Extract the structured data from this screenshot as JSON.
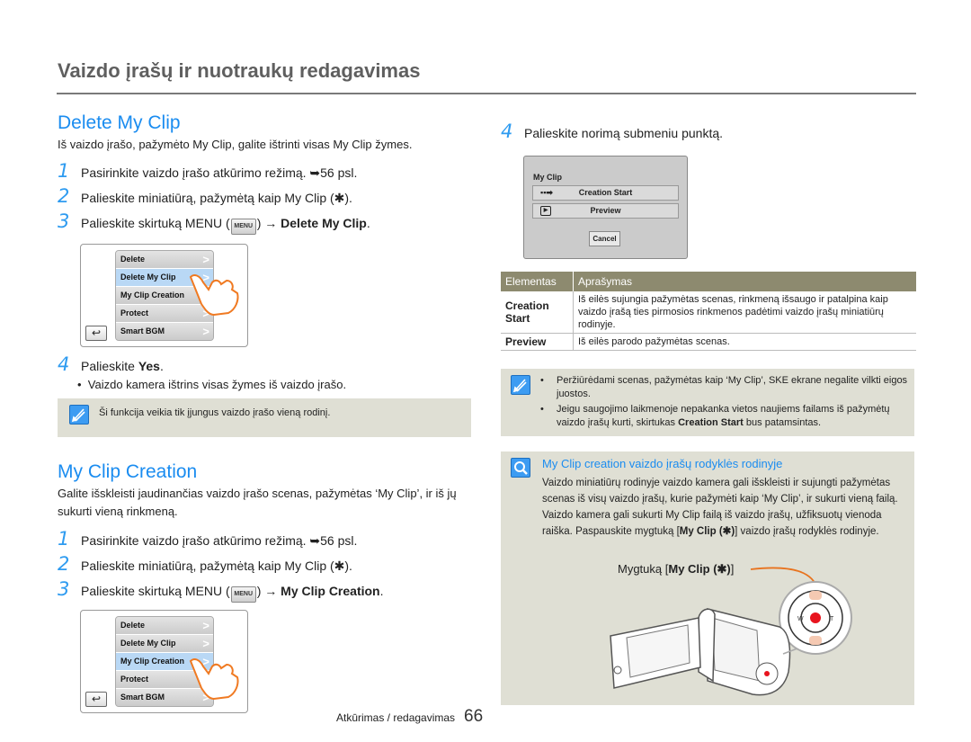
{
  "page": {
    "title": "Vaizdo įrašų ir nuotraukų redagavimas",
    "footer_section": "Atkūrimas / redagavimas",
    "page_number": "66"
  },
  "delete_section": {
    "title": "Delete My Clip",
    "intro": "Iš vaizdo įrašo, pažymėto My Clip, galite ištrinti visas My Clip žymes.",
    "steps": [
      {
        "num": "1",
        "text": "Pasirinkite vaizdo įrašo atkūrimo režimą. ➥56 psl."
      },
      {
        "num": "2",
        "text": "Palieskite miniatiūrą, pažymėtą kaip My Clip (✱)."
      },
      {
        "num": "3",
        "text_before": "Palieskite skirtuką MENU (",
        "menu_icon": "MENU",
        "text_after": ") → ",
        "bold": "Delete My Clip",
        "end": "."
      }
    ],
    "menu_items": [
      {
        "label": "Delete",
        "selected": false
      },
      {
        "label": "Delete My Clip",
        "selected": true
      },
      {
        "label": "My Clip Creation",
        "selected": false
      },
      {
        "label": "Protect",
        "selected": false
      },
      {
        "label": "Smart BGM",
        "selected": false
      }
    ],
    "step4": {
      "num": "4",
      "text": "Palieskite ",
      "bold": "Yes",
      "end": "."
    },
    "bullet": "Vaizdo kamera ištrins visas žymes iš vaizdo įrašo.",
    "note": "Ši funkcija veikia tik įjungus vaizdo įrašo vieną rodinį."
  },
  "creation_section": {
    "title": "My Clip Creation",
    "intro": "Galite išskleisti jaudinančias vaizdo įrašo scenas, pažymėtas ‘My Clip’, ir iš jų sukurti vieną rinkmeną.",
    "steps": [
      {
        "num": "1",
        "text": "Pasirinkite vaizdo įrašo atkūrimo režimą. ➥56 psl."
      },
      {
        "num": "2",
        "text": "Palieskite miniatiūrą, pažymėtą kaip My Clip (✱)."
      },
      {
        "num": "3",
        "text_before": "Palieskite skirtuką MENU (",
        "menu_icon": "MENU",
        "text_after": ") → ",
        "bold": "My Clip Creation",
        "end": "."
      }
    ],
    "menu_items": [
      {
        "label": "Delete",
        "selected": false
      },
      {
        "label": "Delete My Clip",
        "selected": false
      },
      {
        "label": "My Clip Creation",
        "selected": true
      },
      {
        "label": "Protect",
        "selected": false
      },
      {
        "label": "Smart BGM",
        "selected": false
      }
    ]
  },
  "right": {
    "step4": {
      "num": "4",
      "text": "Palieskite norimą submeniu punktą."
    },
    "dialog": {
      "title": "My Clip",
      "buttons": [
        {
          "icon": "creation-start-icon",
          "label": "Creation Start"
        },
        {
          "icon": "preview-play-icon",
          "label": "Preview"
        }
      ],
      "cancel": "Cancel"
    },
    "table": {
      "headers": [
        "Elementas",
        "Aprašymas"
      ],
      "rows": [
        {
          "key": "Creation Start",
          "value": "Iš eilės sujungia pažymėtas scenas, rinkmeną išsaugo ir patalpina kaip vaizdo įrašą ties pirmosios rinkmenos padėtimi vaizdo įrašų miniatiūrų rodinyje."
        },
        {
          "key": "Preview",
          "value": "Iš eilės parodo pažymėtas scenas."
        }
      ]
    },
    "notes": [
      "Peržiūrėdami scenas, pažymėtas kaip ‘My Clip’, SKE ekrane negalite vilkti eigos juostos.",
      {
        "before": "Jeigu saugojimo laikmenoje nepakanka vietos naujiems failams iš pažymėtų vaizdo įrašų kurti, skirtukas ",
        "bold": "Creation Start",
        "after": " bus patamsintas."
      }
    ],
    "tip": {
      "title": "My Clip creation vaizdo įrašų rodyklės rodinyje",
      "body_before": "Vaizdo miniatiūrų rodinyje vaizdo kamera gali išskleisti ir sujungti pažymėtas scenas iš visų vaizdo įrašų, kurie pažymėti kaip ‘My Clip’, ir sukurti vieną failą. Vaizdo kamera gali sukurti My Clip failą iš vaizdo įrašų, užfiksuotų vienoda raiška. Paspauskite mygtuką [",
      "body_bold": "My Clip (✱)",
      "body_after": "] vaizdo įrašų rodyklės rodinyje.",
      "callout_before": "Mygtuką [",
      "callout_bold": "My Clip (✱)",
      "callout_after": "]",
      "dial_labels": {
        "left": "W",
        "right": "T"
      }
    }
  },
  "colors": {
    "section_blue": "#1a8cf0",
    "note_bg": "#dfdfd4",
    "table_header": "#8d8a6f",
    "callout_orange": "#e8731e",
    "record_red": "#e8141e"
  }
}
